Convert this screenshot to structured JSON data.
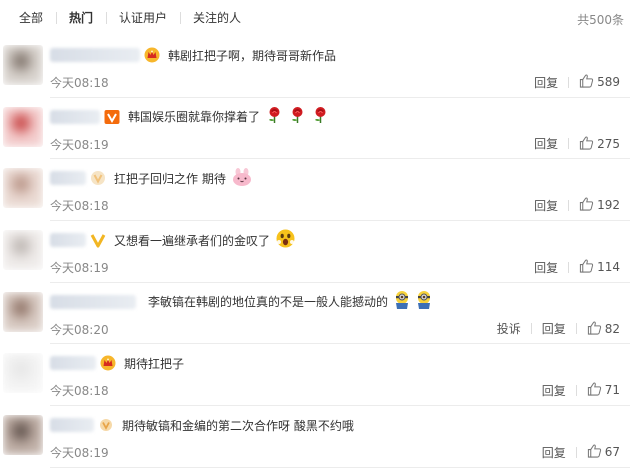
{
  "tabs": [
    "全部",
    "热门",
    "认证用户",
    "关注的人"
  ],
  "active_tab": 1,
  "total": "共500条",
  "actions": {
    "reply": "回复",
    "report": "投诉"
  },
  "comments": [
    {
      "name_width": 90,
      "badge": "crown-badge",
      "text": "韩剧扛把子啊，期待哥哥新作品",
      "emoji": [],
      "time": "今天08:18",
      "likes": "589",
      "report": false,
      "avatar_colors": [
        "#d2ccc6",
        "#7b6e66",
        "#e6e2df"
      ]
    },
    {
      "name_width": 50,
      "badge": "v-badge",
      "text": "韩国娱乐圈就靠你撑着了",
      "emoji": [
        "rose-emoji",
        "rose-emoji",
        "rose-emoji"
      ],
      "time": "今天08:19",
      "likes": "275",
      "report": false,
      "avatar_colors": [
        "#f2c6c6",
        "#c43a3a",
        "#f5dcdc"
      ]
    },
    {
      "name_width": 36,
      "badge": "v-faded-badge",
      "text": "扛把子回归之作 期待",
      "emoji": [
        "bunny-emoji"
      ],
      "time": "今天08:18",
      "likes": "192",
      "report": false,
      "avatar_colors": [
        "#e8d6cf",
        "#b69183",
        "#efe4dd"
      ]
    },
    {
      "name_width": 36,
      "badge": "v-gold-badge",
      "text": "又想看一遍继承者们的金叹了",
      "emoji": [
        "shocked-emoji"
      ],
      "time": "今天08:19",
      "likes": "114",
      "report": false,
      "avatar_colors": [
        "#ece8e6",
        "#b9b2ae",
        "#f4f2f1"
      ]
    },
    {
      "name_width": 86,
      "badge": "none",
      "text": "李敏镐在韩剧的地位真的不是一般人能撼动的",
      "emoji": [
        "minion-emoji",
        "minion-emoji"
      ],
      "time": "今天08:20",
      "likes": "82",
      "report": true,
      "avatar_colors": [
        "#d4c5bd",
        "#8c6f62",
        "#e4dad4"
      ]
    },
    {
      "name_width": 46,
      "badge": "crown-badge",
      "text": "期待扛把子",
      "emoji": [],
      "time": "今天08:18",
      "likes": "71",
      "report": false,
      "avatar_colors": [
        "#f2f2f2",
        "#e6e6e6",
        "#fafafa"
      ]
    },
    {
      "name_width": 44,
      "badge": "v-small-badge",
      "text": "期待敏镐和金编的第二次合作呀 酸黑不约哦",
      "emoji": [],
      "time": "今天08:19",
      "likes": "67",
      "report": false,
      "avatar_colors": [
        "#b8a79e",
        "#5b4d47",
        "#d1c4bd"
      ]
    }
  ]
}
